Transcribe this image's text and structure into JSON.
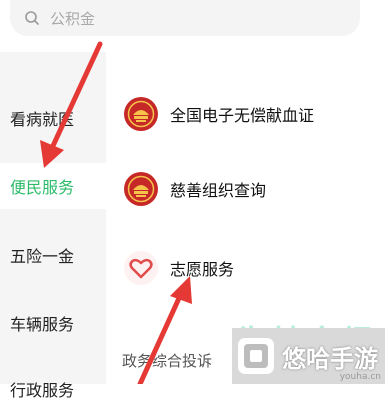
{
  "search": {
    "placeholder": "公积金",
    "icon": "search-icon"
  },
  "sidebar": {
    "items": [
      {
        "label": "看病就医",
        "active": false
      },
      {
        "label": "便民服务",
        "active": true
      },
      {
        "label": "五险一金",
        "active": false
      },
      {
        "label": "车辆服务",
        "active": false
      },
      {
        "label": "行政服务",
        "active": false
      }
    ]
  },
  "services": [
    {
      "label": "全国电子无偿献血证",
      "icon": "red-emblem-icon"
    },
    {
      "label": "慈善组织查询",
      "icon": "red-emblem-icon"
    },
    {
      "label": "志愿服务",
      "icon": "heart-icon"
    }
  ],
  "section": {
    "title": "政务综合投诉"
  },
  "watermark": {
    "text": "悠哈手游",
    "url": "youha.cn"
  },
  "colors": {
    "accent": "#2dbb6a",
    "arrow": "#e53935",
    "emblem": "#c62828"
  }
}
